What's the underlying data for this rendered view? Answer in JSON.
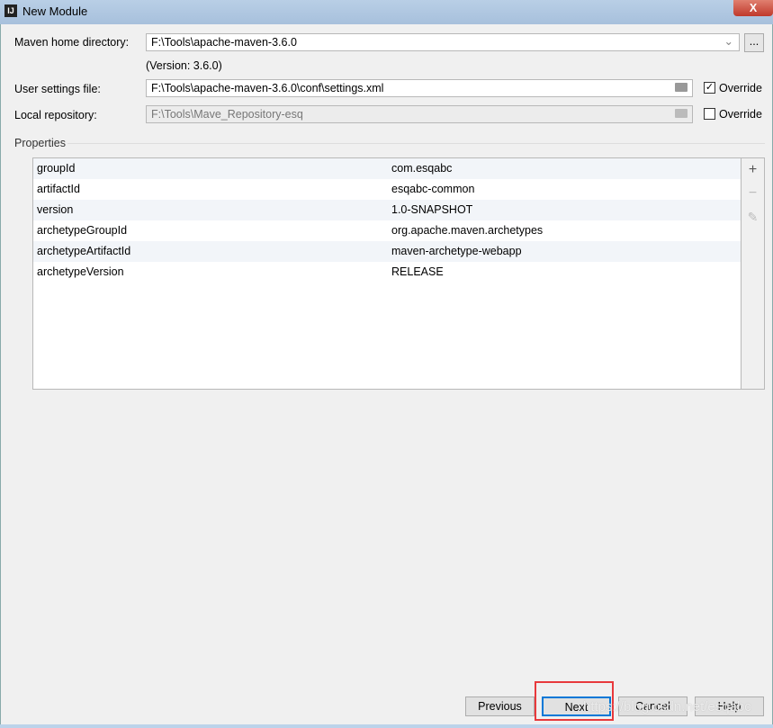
{
  "window": {
    "title": "New Module",
    "close": "X",
    "app_icon": "IJ"
  },
  "form": {
    "maven_home_label": "Maven home directory:",
    "maven_home_value": "F:\\Tools\\apache-maven-3.6.0",
    "browse_label": "...",
    "version_note": "(Version: 3.6.0)",
    "settings_label": "User settings file:",
    "settings_value": "F:\\Tools\\apache-maven-3.6.0\\conf\\settings.xml",
    "settings_override": "Override",
    "settings_override_checked": true,
    "repo_label": "Local repository:",
    "repo_value": "F:\\Tools\\Mave_Repository-esq",
    "repo_override": "Override",
    "repo_override_checked": false
  },
  "properties": {
    "title": "Properties",
    "rows": [
      {
        "key": "groupId",
        "value": "com.esqabc"
      },
      {
        "key": "artifactId",
        "value": "esqabc-common"
      },
      {
        "key": "version",
        "value": "1.0-SNAPSHOT"
      },
      {
        "key": "archetypeGroupId",
        "value": "org.apache.maven.archetypes"
      },
      {
        "key": "archetypeArtifactId",
        "value": "maven-archetype-webapp"
      },
      {
        "key": "archetypeVersion",
        "value": "RELEASE"
      }
    ],
    "add": "+",
    "remove": "−",
    "edit": "✎"
  },
  "buttons": {
    "previous": "Previous",
    "next": "Next",
    "cancel": "Cancel",
    "help": "Help"
  },
  "watermark": "https://blog.csdn.net/esqabc"
}
